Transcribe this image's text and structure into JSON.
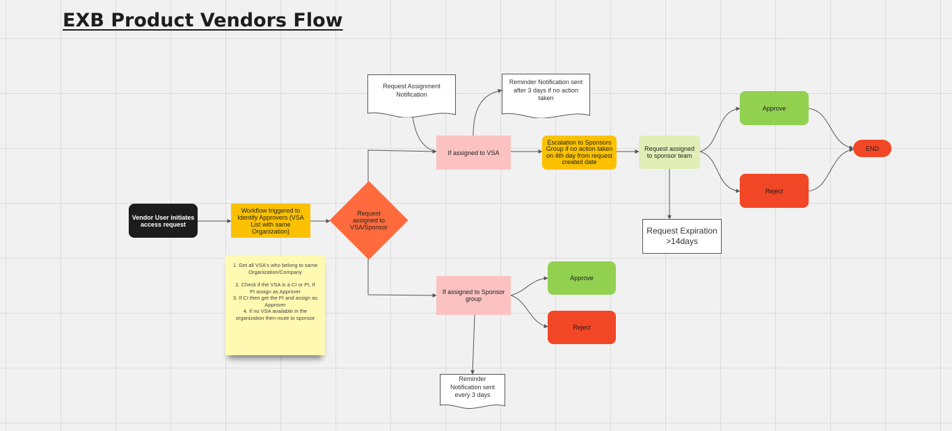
{
  "title": "EXB Product Vendors Flow",
  "nodes": {
    "start": "Vendor User initiates access request",
    "workflow": "Workflow triggered to Identify Approvers (VSA List with same Organization)",
    "decision": "Request assigned to VSA/Sponsor",
    "vsa": "If assigned to VSA",
    "sponsor_group": "If assigned to Sponsor group",
    "assignment_notification": "Request Assignment Notification",
    "reminder_vsa": "Reminder Notification sent after 3 days if no action taken",
    "escalation": "Escalation to Sponsors Group if no action taken on 4th day from request created date",
    "sponsor_team": "Request assigned to sponsor team",
    "approve_top": "Approve",
    "reject_top": "Reject",
    "end": "END",
    "expiration": "Request Expiration >14days",
    "approve_bottom": "Approve",
    "reject_bottom": "Reject",
    "reminder_sponsor": "Reminder Notification sent every 3 days"
  },
  "sticky_note": {
    "lines": [
      "1. Get all VSA's who belong to same Organization/Company",
      "",
      "2. Check if the VSA is a CI or PI, If PI assign as Approver",
      "3. If CI then get the PI and assign as Approver",
      "4. If no VSA available in the organization then route to sponsor"
    ]
  },
  "colors": {
    "start": "#1c1c1c",
    "workflow": "#fbc100",
    "decision": "#ff6b3d",
    "assignee": "#fcc2c2",
    "escalation": "#fbc100",
    "sponsor_team": "#e1efb6",
    "approve": "#92d050",
    "reject": "#f24726",
    "end": "#f24726",
    "sticky": "#fff9b1"
  }
}
